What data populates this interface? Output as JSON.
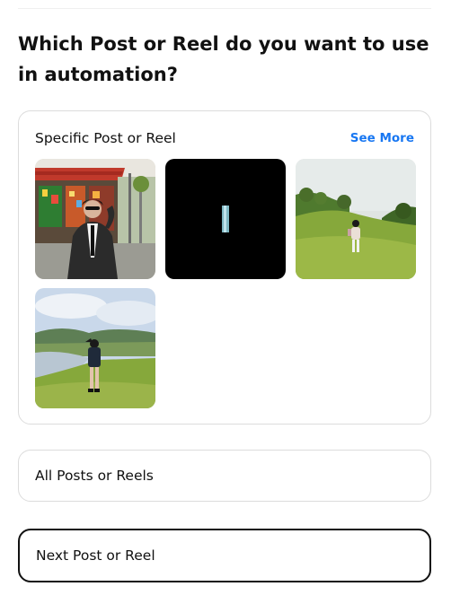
{
  "heading": "Which Post or Reel do you want to use in automation?",
  "specific_card": {
    "title": "Specific Post or Reel",
    "see_more_label": "See More",
    "posts": [
      {
        "alt": "Person in black jacket and tie posing in front of a colorful market stall"
      },
      {
        "alt": "Black frame with a thin vertical light strip"
      },
      {
        "alt": "Person in white outfit walking on a green hill"
      },
      {
        "alt": "Person in dark jacket standing on grass beside a lake"
      }
    ]
  },
  "options": {
    "all_label": "All Posts or Reels",
    "next_label": "Next Post or Reel"
  },
  "colors": {
    "accent_link": "#1877f2",
    "border": "#dcdcdc",
    "selected_border": "#111111"
  }
}
